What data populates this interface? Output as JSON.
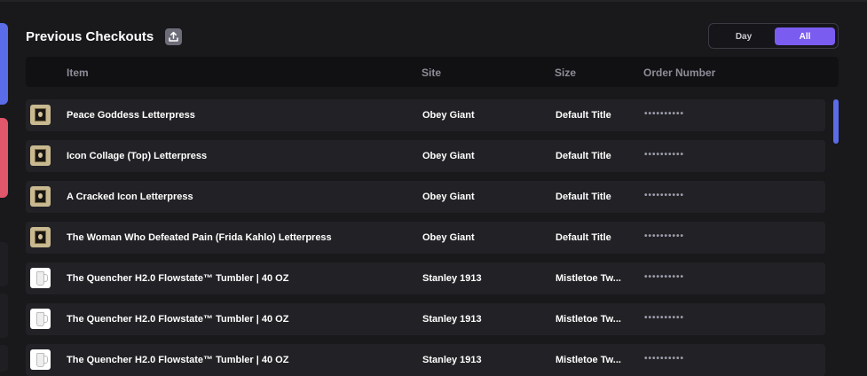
{
  "header": {
    "title": "Previous Checkouts",
    "export_icon": "upload-icon"
  },
  "filter": {
    "options": [
      "Day",
      "All"
    ],
    "selected": "All",
    "accent_color": "#7b5cf0"
  },
  "table": {
    "columns": [
      "Item",
      "Site",
      "Size",
      "Order Number"
    ],
    "rows": [
      {
        "item": "Peace Goddess Letterpress",
        "site": "Obey Giant",
        "size": "Default Title",
        "order": "••••••••••",
        "thumb": "poster"
      },
      {
        "item": "Icon Collage (Top) Letterpress",
        "site": "Obey Giant",
        "size": "Default Title",
        "order": "••••••••••",
        "thumb": "poster"
      },
      {
        "item": "A Cracked Icon Letterpress",
        "site": "Obey Giant",
        "size": "Default Title",
        "order": "••••••••••",
        "thumb": "poster"
      },
      {
        "item": "The Woman Who Defeated Pain (Frida Kahlo) Letterpress",
        "site": "Obey Giant",
        "size": "Default Title",
        "order": "••••••••••",
        "thumb": "poster"
      },
      {
        "item": "The Quencher H2.0 Flowstate™ Tumbler | 40 OZ",
        "site": "Stanley 1913",
        "size": "Mistletoe Tw...",
        "order": "••••••••••",
        "thumb": "tumbler"
      },
      {
        "item": "The Quencher H2.0 Flowstate™ Tumbler | 40 OZ",
        "site": "Stanley 1913",
        "size": "Mistletoe Tw...",
        "order": "••••••••••",
        "thumb": "tumbler"
      },
      {
        "item": "The Quencher H2.0 Flowstate™ Tumbler | 40 OZ",
        "site": "Stanley 1913",
        "size": "Mistletoe Tw...",
        "order": "••••••••••",
        "thumb": "tumbler"
      }
    ]
  },
  "colors": {
    "background": "#19191c",
    "row": "#222226",
    "scrollbar": "#5b6ce8",
    "accent_blue": "#5b6ce8",
    "accent_red": "#e0566a"
  }
}
